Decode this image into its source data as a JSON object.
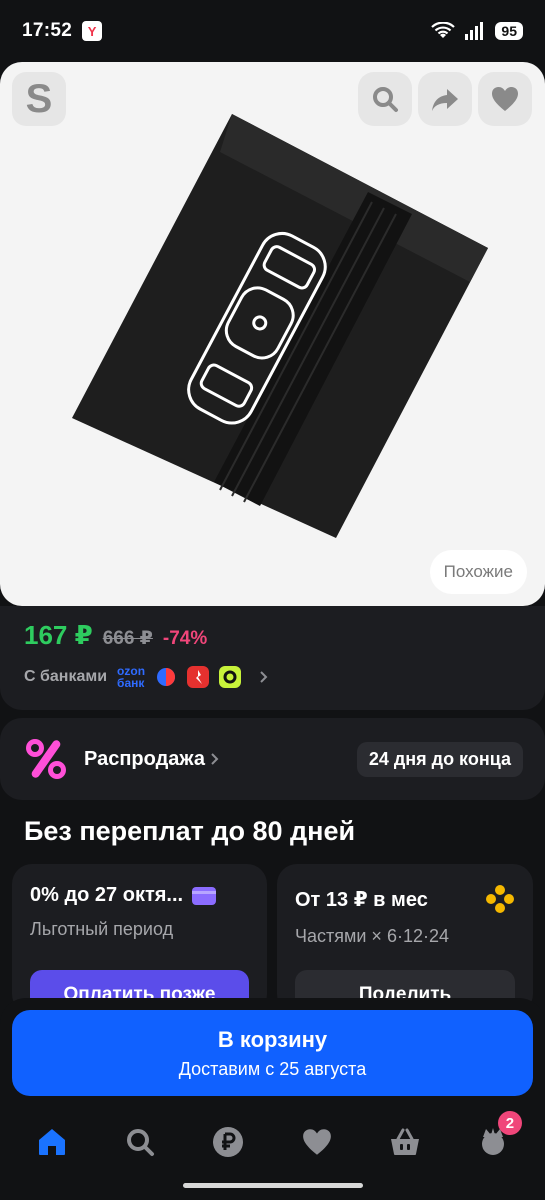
{
  "status": {
    "time": "17:52",
    "battery": "95",
    "app_icon_letter": "Y"
  },
  "product": {
    "similar_label": "Похожие"
  },
  "price": {
    "current": "167 ₽",
    "old": "666 ₽",
    "discount": "-74%",
    "banks_label": "С банками",
    "ozon_bank_line1": "ozon",
    "ozon_bank_line2": "банк"
  },
  "sale": {
    "title": "Распродажа",
    "badge": "24 дня до конца"
  },
  "installment": {
    "heading": "Без переплат до 80 дней",
    "card1": {
      "title": "0% до 27 октя...",
      "subtitle": "Льготный период",
      "button": "Оплатить позже"
    },
    "card2": {
      "title": "От 13 ₽ в мес",
      "subtitle": "Частями × 6·12·24",
      "button": "Поделить"
    }
  },
  "cart": {
    "title": "В корзину",
    "subtitle": "Доставим с 25 августа"
  },
  "nav": {
    "cart_badge": "2"
  },
  "colors": {
    "accent_blue": "#1061ff",
    "price_green": "#2ecc5f",
    "discount_pink": "#f0467a"
  }
}
